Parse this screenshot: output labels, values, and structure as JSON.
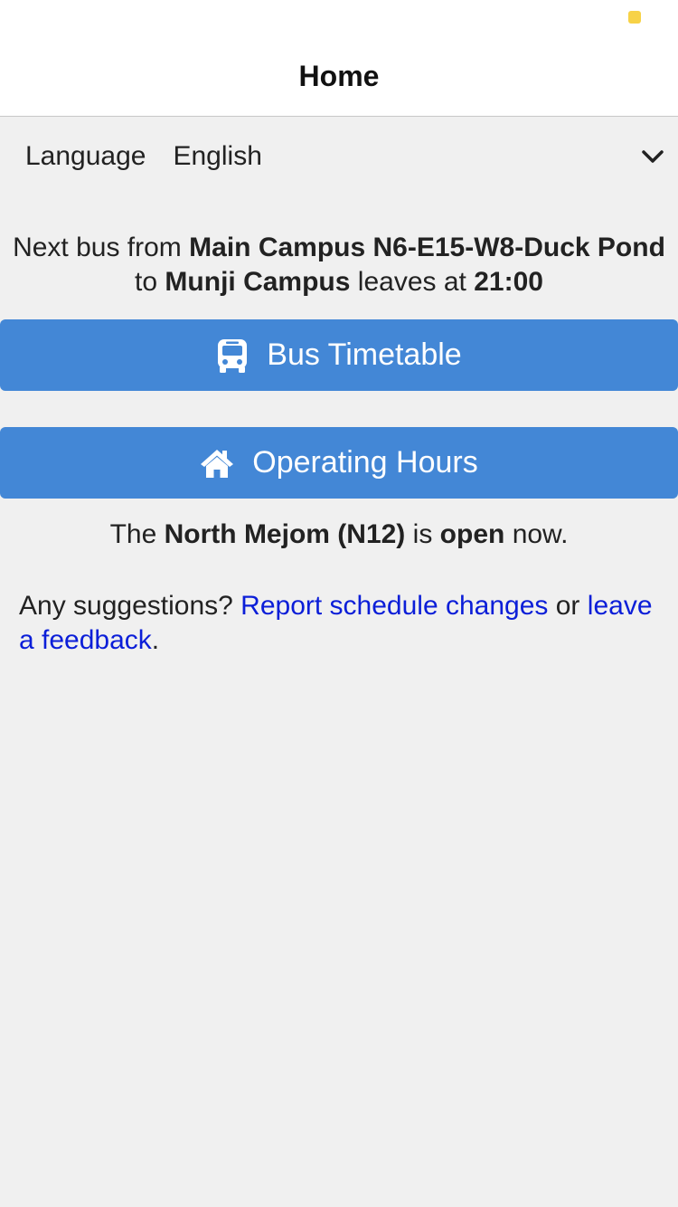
{
  "nav": {
    "title": "Home"
  },
  "language": {
    "label": "Language",
    "value": "English"
  },
  "next_bus": {
    "prefix": "Next bus from",
    "from": "Main Campus N6-E15-W8-Duck Pond",
    "to_word": "to",
    "to": "Munji Campus",
    "leaves_word": "leaves at",
    "time": "21:00"
  },
  "buttons": {
    "bus_timetable": "Bus Timetable",
    "operating_hours": "Operating Hours"
  },
  "hours_status": {
    "prefix": "The",
    "place": "North Mejom (N12)",
    "is_word": "is",
    "state": "open",
    "suffix": "now."
  },
  "suggestions": {
    "prefix": "Any suggestions?",
    "report_link": "Report schedule changes",
    "or_word": "or",
    "feedback_link": "leave a feedback",
    "end": "."
  },
  "colors": {
    "accent_button": "#4387d6",
    "link": "#0b1ed8",
    "status_dot": "#f7d247"
  },
  "icons": {
    "bus": "bus-icon",
    "home": "home-icon",
    "dropdown": "chevron-down-icon"
  }
}
